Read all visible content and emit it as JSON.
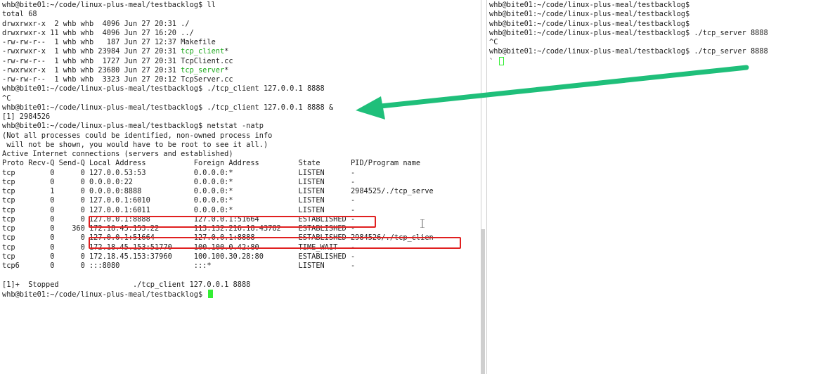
{
  "left_terminal": {
    "lines": [
      {
        "text": "whb@bite01:~/code/linux-plus-meal/testbacklog$ ll"
      },
      {
        "text": "total 68"
      },
      {
        "text": "drwxrwxr-x  2 whb whb  4096 Jun 27 20:31 ./"
      },
      {
        "text": "drwxrwxr-x 11 whb whb  4096 Jun 27 16:20 ../"
      },
      {
        "text": "-rw-rw-r--  1 whb whb   187 Jun 27 12:37 Makefile"
      },
      {
        "prefix": "-rwxrwxr-x  1 whb whb 23984 Jun 27 20:31 ",
        "exe": "tcp_client",
        "suffix": "*"
      },
      {
        "text": "-rw-rw-r--  1 whb whb  1727 Jun 27 20:31 TcpClient.cc"
      },
      {
        "prefix": "-rwxrwxr-x  1 whb whb 23680 Jun 27 20:31 ",
        "exe": "tcp_server",
        "suffix": "*"
      },
      {
        "text": "-rw-rw-r--  1 whb whb  3323 Jun 27 20:12 TcpServer.cc"
      },
      {
        "text": "whb@bite01:~/code/linux-plus-meal/testbacklog$ ./tcp_client 127.0.0.1 8888"
      },
      {
        "text": "^C"
      },
      {
        "text": "whb@bite01:~/code/linux-plus-meal/testbacklog$ ./tcp_client 127.0.0.1 8888 &"
      },
      {
        "text": "[1] 2984526"
      },
      {
        "text": "whb@bite01:~/code/linux-plus-meal/testbacklog$ netstat -natp"
      },
      {
        "text": "(Not all processes could be identified, non-owned process info"
      },
      {
        "text": " will not be shown, you would have to be root to see it all.)"
      },
      {
        "text": "Active Internet connections (servers and established)"
      },
      {
        "text": "Proto Recv-Q Send-Q Local Address           Foreign Address         State       PID/Program name"
      },
      {
        "text": "tcp        0      0 127.0.0.53:53           0.0.0.0:*               LISTEN      -"
      },
      {
        "text": "tcp        0      0 0.0.0.0:22              0.0.0.0:*               LISTEN      -"
      },
      {
        "text": "tcp        1      0 0.0.0.0:8888            0.0.0.0:*               LISTEN      2984525/./tcp_serve"
      },
      {
        "text": "tcp        0      0 127.0.0.1:6010          0.0.0.0:*               LISTEN      -"
      },
      {
        "text": "tcp        0      0 127.0.0.1:6011          0.0.0.0:*               LISTEN      -"
      },
      {
        "text": "tcp        0      0 127.0.0.1:8888          127.0.0.1:51664         ESTABLISHED -"
      },
      {
        "text": "tcp        0    360 172.18.45.153:22        113.132.216.18:43782    ESTABLISHED -"
      },
      {
        "text": "tcp        0      0 127.0.0.1:51664         127.0.0.1:8888          ESTABLISHED 2984526/./tcp_clien"
      },
      {
        "text": "tcp        0      0 172.18.45.153:51770     100.100.0.42:80         TIME_WAIT   -"
      },
      {
        "text": "tcp        0      0 172.18.45.153:37960     100.100.30.28:80        ESTABLISHED -"
      },
      {
        "text": "tcp6       0      0 :::8080                 :::*                    LISTEN      -"
      },
      {
        "text": ""
      },
      {
        "text": "[1]+  Stopped                 ./tcp_client 127.0.0.1 8888"
      }
    ],
    "prompt": "whb@bite01:~/code/linux-plus-meal/testbacklog$ "
  },
  "right_terminal": {
    "lines": [
      {
        "text": "whb@bite01:~/code/linux-plus-meal/testbacklog$"
      },
      {
        "text": "whb@bite01:~/code/linux-plus-meal/testbacklog$"
      },
      {
        "text": "whb@bite01:~/code/linux-plus-meal/testbacklog$"
      },
      {
        "text": "whb@bite01:~/code/linux-plus-meal/testbacklog$ ./tcp_server 8888"
      },
      {
        "text": "^C"
      },
      {
        "text": "whb@bite01:~/code/linux-plus-meal/testbacklog$ ./tcp_server 8888"
      }
    ],
    "last_line": "` "
  },
  "colors": {
    "executable": "#1aa81a",
    "cursor": "#33ee33",
    "highlight_box": "#e02020",
    "arrow": "#1fbf7a"
  }
}
